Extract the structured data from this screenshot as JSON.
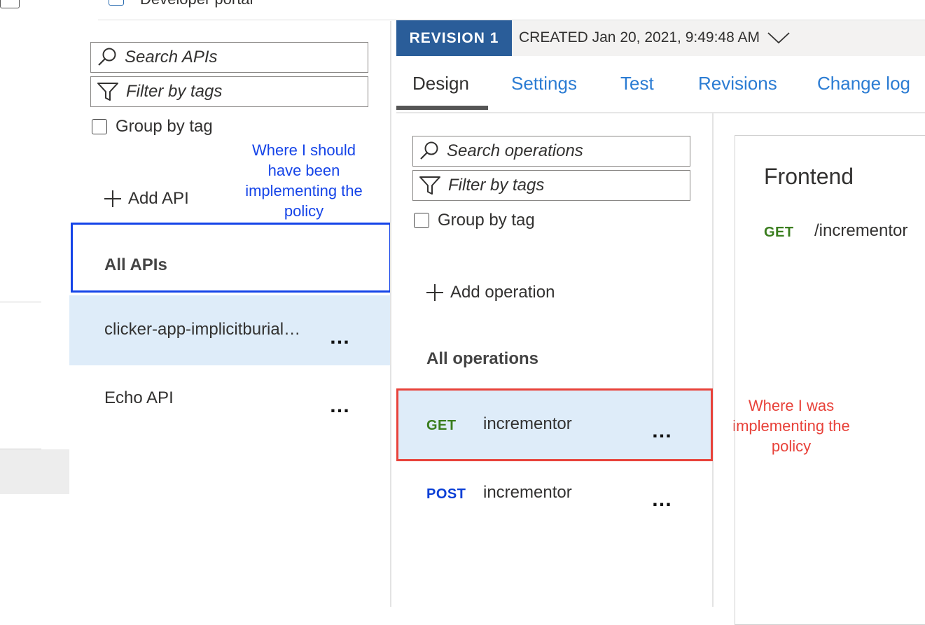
{
  "top": {
    "portal_label": "Developer portal"
  },
  "api_panel": {
    "search_placeholder": "Search APIs",
    "filter_placeholder": "Filter by tags",
    "group_by_tag": "Group by tag",
    "add_api": "Add API",
    "all_apis": "All APIs",
    "apis": [
      {
        "name": "clicker-app-implicitburial…",
        "selected": true
      },
      {
        "name": "Echo API",
        "selected": false
      }
    ]
  },
  "revision": {
    "badge": "REVISION 1",
    "created": "CREATED Jan 20, 2021, 9:49:48 AM"
  },
  "tabs": [
    {
      "label": "Design",
      "active": true
    },
    {
      "label": "Settings"
    },
    {
      "label": "Test"
    },
    {
      "label": "Revisions"
    },
    {
      "label": "Change log"
    }
  ],
  "operations_panel": {
    "search_placeholder": "Search operations",
    "filter_placeholder": "Filter by tags",
    "group_by_tag": "Group by tag",
    "add_operation": "Add operation",
    "all_operations": "All operations",
    "operations": [
      {
        "verb": "GET",
        "name": "incrementor",
        "selected": true
      },
      {
        "verb": "POST",
        "name": "incrementor",
        "selected": false
      }
    ]
  },
  "frontend": {
    "title": "Frontend",
    "verb": "GET",
    "path": "/incrementor"
  },
  "annotations": {
    "blue": "Where I should have been implementing the policy",
    "red": "Where I was implementing the policy"
  },
  "colors": {
    "annotation_blue": "#1544e8",
    "annotation_red": "#e8423a",
    "revision_badge": "#2a5d99",
    "tab_link": "#2b7cd3",
    "selected_row": "#deecf9",
    "get_verb": "#3a7d1e",
    "post_verb": "#0a3fd6"
  }
}
